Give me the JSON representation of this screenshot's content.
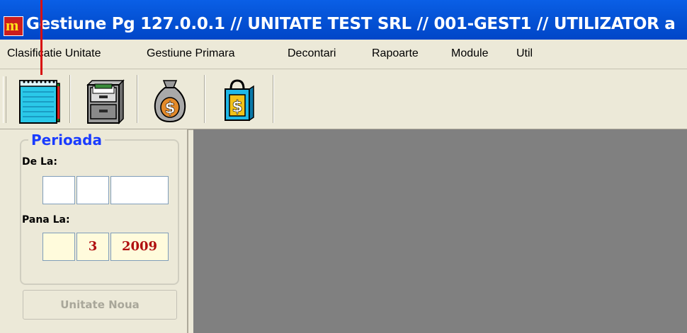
{
  "window": {
    "title": "Gestiune Pg 127.0.0.1 // UNITATE TEST SRL // 001-GEST1 // UTILIZATOR a",
    "app_icon_letter": "m",
    "titlebar_color": "#0553d6"
  },
  "menu": {
    "items": [
      {
        "label": "Clasificatie Unitate"
      },
      {
        "label": "Gestiune Primara"
      },
      {
        "label": "Decontari"
      },
      {
        "label": "Rapoarte"
      },
      {
        "label": "Module"
      },
      {
        "label": "Util"
      }
    ]
  },
  "toolbar": {
    "buttons": [
      {
        "icon": "notebook-icon"
      },
      {
        "icon": "file-cabinet-icon"
      },
      {
        "icon": "money-bag-icon"
      },
      {
        "icon": "shopping-bag-dollar-icon"
      }
    ]
  },
  "period": {
    "title": "Perioada",
    "from_label": "De La:",
    "from": {
      "day": "",
      "month": "",
      "year": ""
    },
    "to_label": "Pana La:",
    "to": {
      "day": "",
      "month": "3",
      "year": "2009"
    }
  },
  "buttons": {
    "new_unit": "Unitate Noua"
  },
  "colors": {
    "accent": "#1a3cff",
    "value_text": "#b01010",
    "workspace": "#808080"
  }
}
